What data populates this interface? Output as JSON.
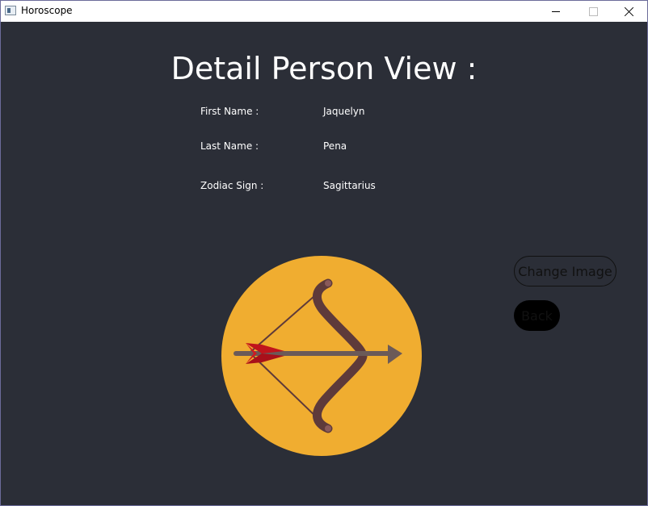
{
  "window": {
    "title": "Horoscope",
    "icons": {
      "app": "app-window-icon",
      "minimize": "minimize-icon",
      "maximize": "maximize-icon",
      "close": "close-icon"
    }
  },
  "page": {
    "heading": "Detail Person View :"
  },
  "person": {
    "first_name_label": "First Name :",
    "first_name": "Jaquelyn",
    "last_name_label": "Last Name :",
    "last_name": "Pena",
    "zodiac_label": "Zodiac Sign :",
    "zodiac": "Sagittarius"
  },
  "image": {
    "icon": "sagittarius-bow-arrow-icon",
    "circle_color": "#f0ad30",
    "bow_color": "#5e3a3a",
    "arrow_color": "#6b5a58",
    "fletching_color": "#c0141c"
  },
  "actions": {
    "change_image_label": "Change Image",
    "back_label": "Back"
  },
  "colors": {
    "background": "#2b2e37",
    "text": "#ffffff"
  }
}
